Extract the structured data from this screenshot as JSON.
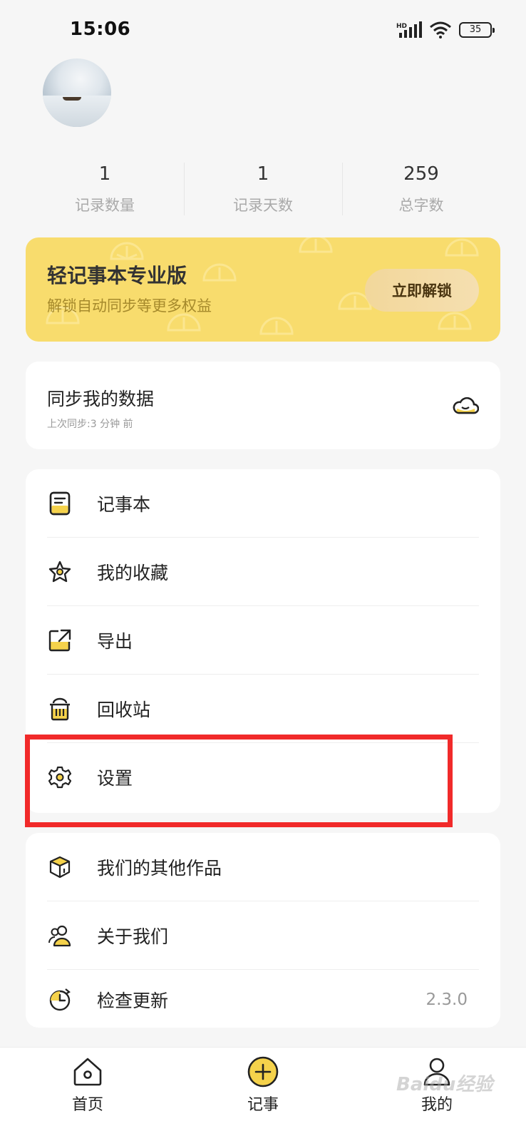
{
  "status_bar": {
    "time": "15:06",
    "network": "HD",
    "battery": "35"
  },
  "stats": [
    {
      "value": "1",
      "label": "记录数量"
    },
    {
      "value": "1",
      "label": "记录天数"
    },
    {
      "value": "259",
      "label": "总字数"
    }
  ],
  "pro": {
    "title": "轻记事本专业版",
    "subtitle": "解锁自动同步等更多权益",
    "button": "立即解锁"
  },
  "sync": {
    "title": "同步我的数据",
    "subtitle": "上次同步:3 分钟 前"
  },
  "menu_group_1": [
    {
      "label": "记事本",
      "icon": "notebook-icon"
    },
    {
      "label": "我的收藏",
      "icon": "star-icon"
    },
    {
      "label": "导出",
      "icon": "export-icon"
    },
    {
      "label": "回收站",
      "icon": "trash-icon"
    },
    {
      "label": "设置",
      "icon": "gear-icon"
    }
  ],
  "menu_group_2": [
    {
      "label": "我们的其他作品",
      "icon": "box-icon"
    },
    {
      "label": "关于我们",
      "icon": "people-icon"
    },
    {
      "label": "检查更新",
      "icon": "update-icon",
      "value": "2.3.0"
    }
  ],
  "tabbar": [
    {
      "label": "首页",
      "icon": "home-icon"
    },
    {
      "label": "记事",
      "icon": "add-icon"
    },
    {
      "label": "我的",
      "icon": "profile-icon"
    }
  ],
  "watermark": "Baidu经验",
  "colors": {
    "accent": "#f8dc6d",
    "icon_yellow": "#f5d24b",
    "highlight": "#f12a2a"
  }
}
